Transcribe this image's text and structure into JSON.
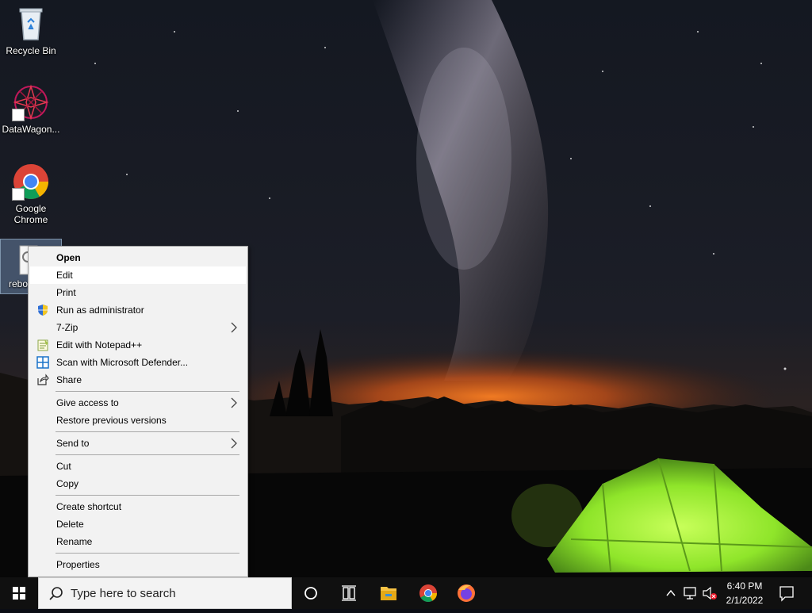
{
  "desktop": {
    "icons": [
      {
        "label": "Recycle Bin"
      },
      {
        "label": "DataWagon..."
      },
      {
        "label": "Google Chrome"
      },
      {
        "label": "rebo"
      }
    ]
  },
  "context_menu": {
    "items": {
      "open": "Open",
      "edit": "Edit",
      "print": "Print",
      "run_as_admin": "Run as administrator",
      "seven_zip": "7-Zip",
      "edit_notepadpp": "Edit with Notepad++",
      "scan_defender": "Scan with Microsoft Defender...",
      "share": "Share",
      "give_access": "Give access to",
      "restore_versions": "Restore previous versions",
      "send_to": "Send to",
      "cut": "Cut",
      "copy": "Copy",
      "create_shortcut": "Create shortcut",
      "delete": "Delete",
      "rename": "Rename",
      "properties": "Properties"
    }
  },
  "taskbar": {
    "search_placeholder": "Type here to search",
    "time": "6:40 PM",
    "date": "2/1/2022",
    "icons": [
      "windows-start-icon",
      "search-icon",
      "cortana-icon",
      "task-view-icon",
      "file-explorer-icon",
      "chrome-icon",
      "firefox-icon",
      "chevron-up-icon",
      "network-icon",
      "volume-muted-icon",
      "notification-icon"
    ]
  },
  "colors": {
    "menu_bg": "#f2f2f2",
    "menu_hover": "#ffffff",
    "taskbar_bg": "#101010",
    "tent_green": "#8fe52a",
    "sunset_orange": "#e2661c"
  }
}
